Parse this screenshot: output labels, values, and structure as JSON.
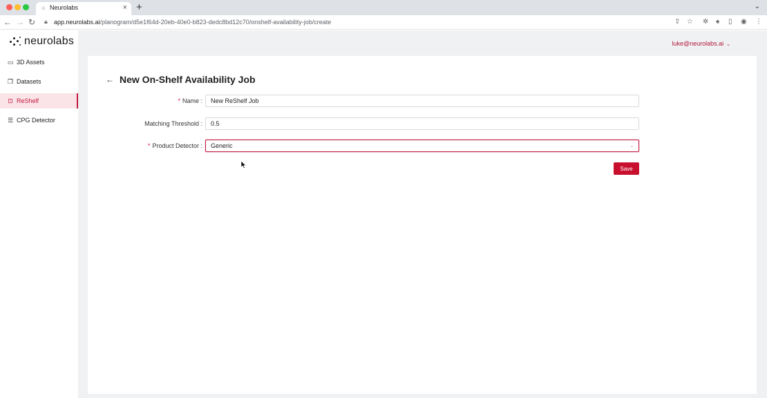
{
  "browser": {
    "tab_title": "Neurolabs",
    "tab_close": "×",
    "new_tab": "+",
    "url_host": "app.neurolabs.ai",
    "url_path": "/planogram/d5e1f64d-20eb-40e0-b823-dedc8bd12c70/onshelf-availability-job/create"
  },
  "app": {
    "logo_text": "neurolabs",
    "user_email": "luke@neurolabs.ai"
  },
  "sidebar": {
    "items": [
      {
        "label": "3D Assets",
        "icon": "folder-icon"
      },
      {
        "label": "Datasets",
        "icon": "copy-icon"
      },
      {
        "label": "ReShelf",
        "icon": "camera-icon",
        "active": true
      },
      {
        "label": "CPG Detector",
        "icon": "list-icon"
      }
    ]
  },
  "form": {
    "title": "New On-Shelf Availability Job",
    "name_label": "Name :",
    "name_value": "New ReShelf Job",
    "threshold_label": "Matching Threshold :",
    "threshold_value": "0.5",
    "detector_label": "Product Detector :",
    "detector_value": "Generic",
    "save_label": "Save",
    "required_mark": "*"
  },
  "colors": {
    "accent": "#c8102e",
    "active_bg": "#fbe4e8"
  }
}
